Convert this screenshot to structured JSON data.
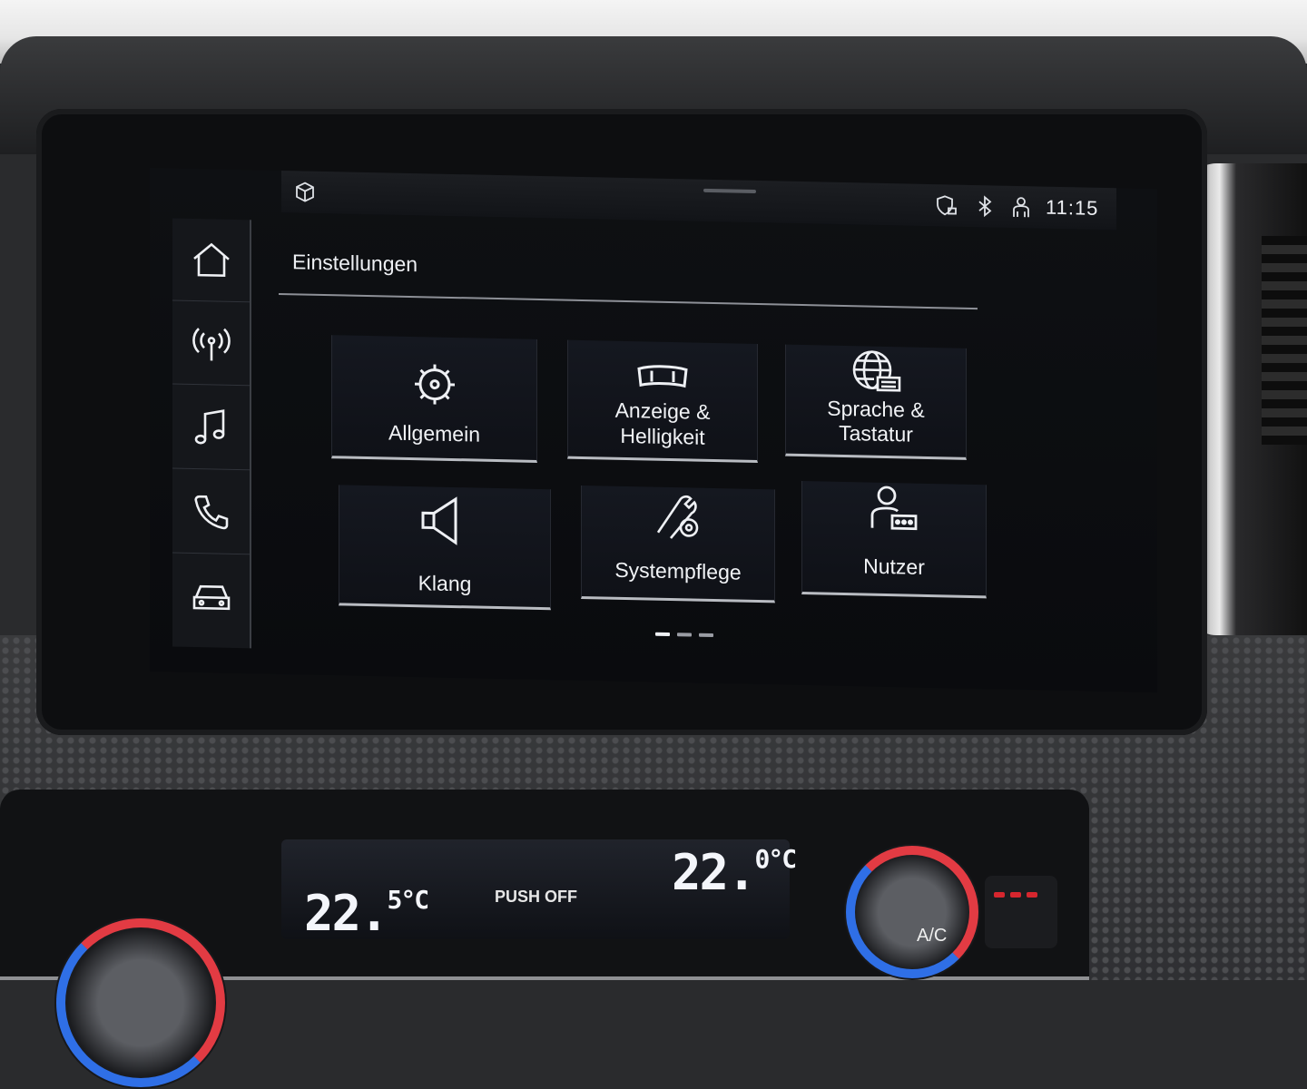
{
  "statusbar": {
    "time": "11:15",
    "icons": [
      "box-icon",
      "shield-lock-icon",
      "bluetooth-icon",
      "driver-profile-icon"
    ]
  },
  "sidebar": {
    "items": [
      {
        "name": "home",
        "icon": "home-icon"
      },
      {
        "name": "radio",
        "icon": "radio-antenna-icon"
      },
      {
        "name": "media",
        "icon": "music-note-icon"
      },
      {
        "name": "phone",
        "icon": "phone-icon"
      },
      {
        "name": "car",
        "icon": "car-icon"
      }
    ]
  },
  "page": {
    "title": "Einstellungen"
  },
  "tiles": [
    {
      "label": "Allgemein",
      "icon": "gear-icon"
    },
    {
      "label": "Anzeige & Helligkeit",
      "label_line1": "Anzeige &",
      "label_line2": "Helligkeit",
      "icon": "display-icon"
    },
    {
      "label": "Sprache & Tastatur",
      "label_line1": "Sprache &",
      "label_line2": "Tastatur",
      "icon": "globe-keyboard-icon"
    },
    {
      "label": "Klang",
      "icon": "speaker-icon"
    },
    {
      "label": "Systempflege",
      "icon": "wrench-gear-icon"
    },
    {
      "label": "Nutzer",
      "icon": "user-icon"
    }
  ],
  "pager": {
    "pages": 3,
    "current": 1
  },
  "climate": {
    "left_temp": "22.5°C",
    "left_temp_main": "22.",
    "left_temp_dec": "5°C",
    "right_temp": "22.0°C",
    "right_temp_main": "22.",
    "right_temp_dec": "0°C",
    "fan_label": "PUSH OFF",
    "ac_label": "A/C"
  },
  "colors": {
    "screen_bg": "#0e1013",
    "text": "#eef0f4",
    "tile_border": "#b9bcc2",
    "hot": "#e23b43",
    "cold": "#2f6fe6"
  }
}
